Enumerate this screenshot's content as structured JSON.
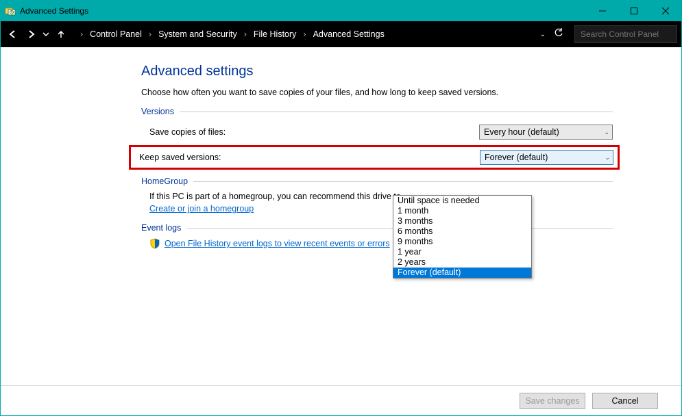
{
  "window": {
    "title": "Advanced Settings"
  },
  "breadcrumbs": {
    "items": [
      "Control Panel",
      "System and Security",
      "File History",
      "Advanced Settings"
    ]
  },
  "search": {
    "placeholder": "Search Control Panel"
  },
  "page": {
    "title": "Advanced settings",
    "description": "Choose how often you want to save copies of your files, and how long to keep saved versions."
  },
  "sections": {
    "versions": {
      "header": "Versions",
      "save_label": "Save copies of files:",
      "save_value": "Every hour (default)",
      "keep_label": "Keep saved versions:",
      "keep_value": "Forever (default)",
      "keep_options": [
        "Until space is needed",
        "1 month",
        "3 months",
        "6 months",
        "9 months",
        "1 year",
        "2 years",
        "Forever (default)"
      ],
      "keep_selected_index": 7
    },
    "homegroup": {
      "header": "HomeGroup",
      "text": "If this PC is part of a homegroup, you can recommend this drive to",
      "link": "Create or join a homegroup"
    },
    "eventlogs": {
      "header": "Event logs",
      "link": "Open File History event logs to view recent events or errors"
    }
  },
  "footer": {
    "save": "Save changes",
    "cancel": "Cancel"
  }
}
